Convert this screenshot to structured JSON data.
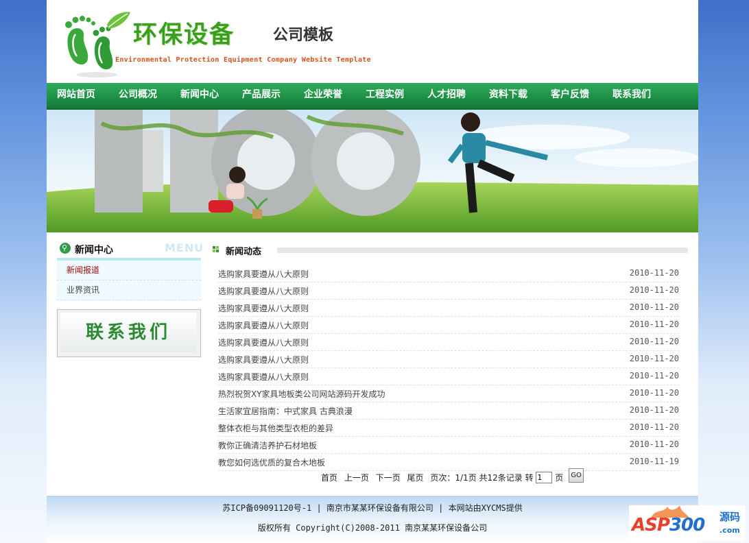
{
  "header": {
    "title": "环保设备",
    "subtitle": "公司模板",
    "english": "Environmental Protection Equipment Company Website Template"
  },
  "nav": {
    "items": [
      {
        "label": "网站首页"
      },
      {
        "label": "公司概况"
      },
      {
        "label": "新闻中心"
      },
      {
        "label": "产品展示"
      },
      {
        "label": "企业荣誉"
      },
      {
        "label": "工程实例"
      },
      {
        "label": "人才招聘"
      },
      {
        "label": "资料下载"
      },
      {
        "label": "客户反馈"
      },
      {
        "label": "联系我们"
      }
    ]
  },
  "sidebar": {
    "title": "新闻中心",
    "menu_word": "MENU",
    "items": [
      {
        "label": "新闻报道"
      },
      {
        "label": "业界资讯"
      }
    ],
    "contact_label": "联系我们"
  },
  "main": {
    "title": "新闻动态",
    "news": [
      {
        "title": "选购家具要遵从八大原则",
        "date": "2010-11-20"
      },
      {
        "title": "选购家具要遵从八大原则",
        "date": "2010-11-20"
      },
      {
        "title": "选购家具要遵从八大原则",
        "date": "2010-11-20"
      },
      {
        "title": "选购家具要遵从八大原则",
        "date": "2010-11-20"
      },
      {
        "title": "选购家具要遵从八大原则",
        "date": "2010-11-20"
      },
      {
        "title": "选购家具要遵从八大原则",
        "date": "2010-11-20"
      },
      {
        "title": "选购家具要遵从八大原则",
        "date": "2010-11-20"
      },
      {
        "title": "热烈祝贺XY家具地板类公司网站源码开发成功",
        "date": "2010-11-20"
      },
      {
        "title": "生活家宜居指南：中式家具 古典浪漫",
        "date": "2010-11-20"
      },
      {
        "title": "整体衣柜与其他类型衣柜的差异",
        "date": "2010-11-20"
      },
      {
        "title": "教你正确清洁养护石材地板",
        "date": "2010-11-20"
      },
      {
        "title": "教您如何选优质的复合木地板",
        "date": "2010-11-19"
      }
    ],
    "pager": {
      "first": "首页",
      "prev": "上一页",
      "next": "下一页",
      "last": "尾页",
      "info": "页次：1/1页 共12条记录 转",
      "page_value": "1",
      "page_suffix": "页",
      "go": "GO"
    }
  },
  "footer": {
    "line1": "苏ICP备09091120号-1 | 南京市某某环保设备有限公司 | 本网站由XYCMS提供",
    "line2": "版权所有 Copyright(C)2008-2011 南京某某环保设备公司"
  },
  "watermark": {
    "brand_a": "ASP",
    "brand_b": "300",
    "cn": "源码",
    "com": ".com"
  },
  "colors": {
    "nav_green": "#1e9147",
    "logo_green": "#3a9f1d",
    "active_red": "#a40d0d"
  }
}
